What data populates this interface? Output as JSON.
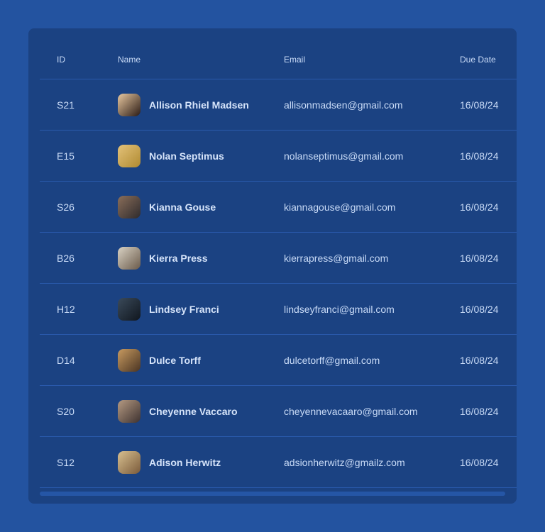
{
  "table": {
    "headers": {
      "id": "ID",
      "name": "Name",
      "email": "Email",
      "due_date": "Due Date"
    },
    "rows": [
      {
        "id": "S21",
        "name": "Allison Rhiel Madsen",
        "email": "allisonmadsen@gmail.com",
        "due_date": "16/08/24",
        "avatar_colors": [
          "#e8c8a0",
          "#2a1a14"
        ]
      },
      {
        "id": "E15",
        "name": "Nolan Septimus",
        "email": "nolanseptimus@gmail.com",
        "due_date": "16/08/24",
        "avatar_colors": [
          "#e3c27a",
          "#b08a30"
        ]
      },
      {
        "id": "S26",
        "name": "Kianna Gouse",
        "email": "kiannagouse@gmail.com",
        "due_date": "16/08/24",
        "avatar_colors": [
          "#8a6e5a",
          "#2e2a2c"
        ]
      },
      {
        "id": "B26",
        "name": "Kierra Press",
        "email": "kierrapress@gmail.com",
        "due_date": "16/08/24",
        "avatar_colors": [
          "#d9d2c4",
          "#6a5a4a"
        ]
      },
      {
        "id": "H12",
        "name": "Lindsey Franci",
        "email": "lindseyfranci@gmail.com",
        "due_date": "16/08/24",
        "avatar_colors": [
          "#3a4a5a",
          "#10161e"
        ]
      },
      {
        "id": "D14",
        "name": "Dulce Torff",
        "email": "dulcetorff@gmail.com",
        "due_date": "16/08/24",
        "avatar_colors": [
          "#c79a60",
          "#4a3422"
        ]
      },
      {
        "id": "S20",
        "name": "Cheyenne Vaccaro",
        "email": "cheyennevacaaro@gmail.com",
        "due_date": "16/08/24",
        "avatar_colors": [
          "#b59a82",
          "#3e3230"
        ]
      },
      {
        "id": "S12",
        "name": "Adison Herwitz",
        "email": "adsionherwitz@gmailz.com",
        "due_date": "16/08/24",
        "avatar_colors": [
          "#d8c090",
          "#7a5a3a"
        ]
      }
    ]
  }
}
